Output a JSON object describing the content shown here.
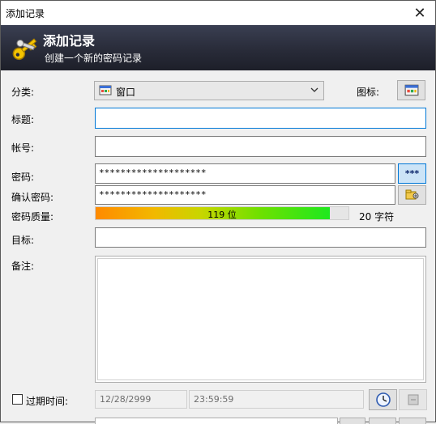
{
  "window": {
    "title": "添加记录",
    "close_glyph": "✕"
  },
  "banner": {
    "title": "添加记录",
    "subtitle": "创建一个新的密码记录"
  },
  "form": {
    "category_label": "分类:",
    "category_value": "窗口",
    "icon_label": "图标:",
    "title_label": "标题:",
    "title_value": "",
    "account_label": "帐号:",
    "account_value": "",
    "password_label": "密码:",
    "password_value": "********************",
    "show_password_label": "***",
    "confirm_label": "确认密码:",
    "confirm_value": "********************",
    "quality_label": "密码质量:",
    "quality_bits": "119 位",
    "quality_fraction": 0.925,
    "quality_chars": "20 字符",
    "target_label": "目标:",
    "target_value": "",
    "notes_label": "备注:",
    "notes_value": "",
    "expire_label": "过期时间:",
    "expire_checked": false,
    "expire_date": "12/28/2999",
    "expire_time": "23:59:59"
  },
  "icons": {
    "logo": "keys-icon",
    "category": "window-icon",
    "icon_picker": "window-icon",
    "generate": "password-generator-icon",
    "expire_clock": "clock-icon",
    "expire_menu": "menu-icon"
  },
  "colors": {
    "banner_bg": "#2a2d3b",
    "focus_border": "#0078d7",
    "quality_high": "#1ee81e",
    "quality_low": "#ff8a00"
  }
}
